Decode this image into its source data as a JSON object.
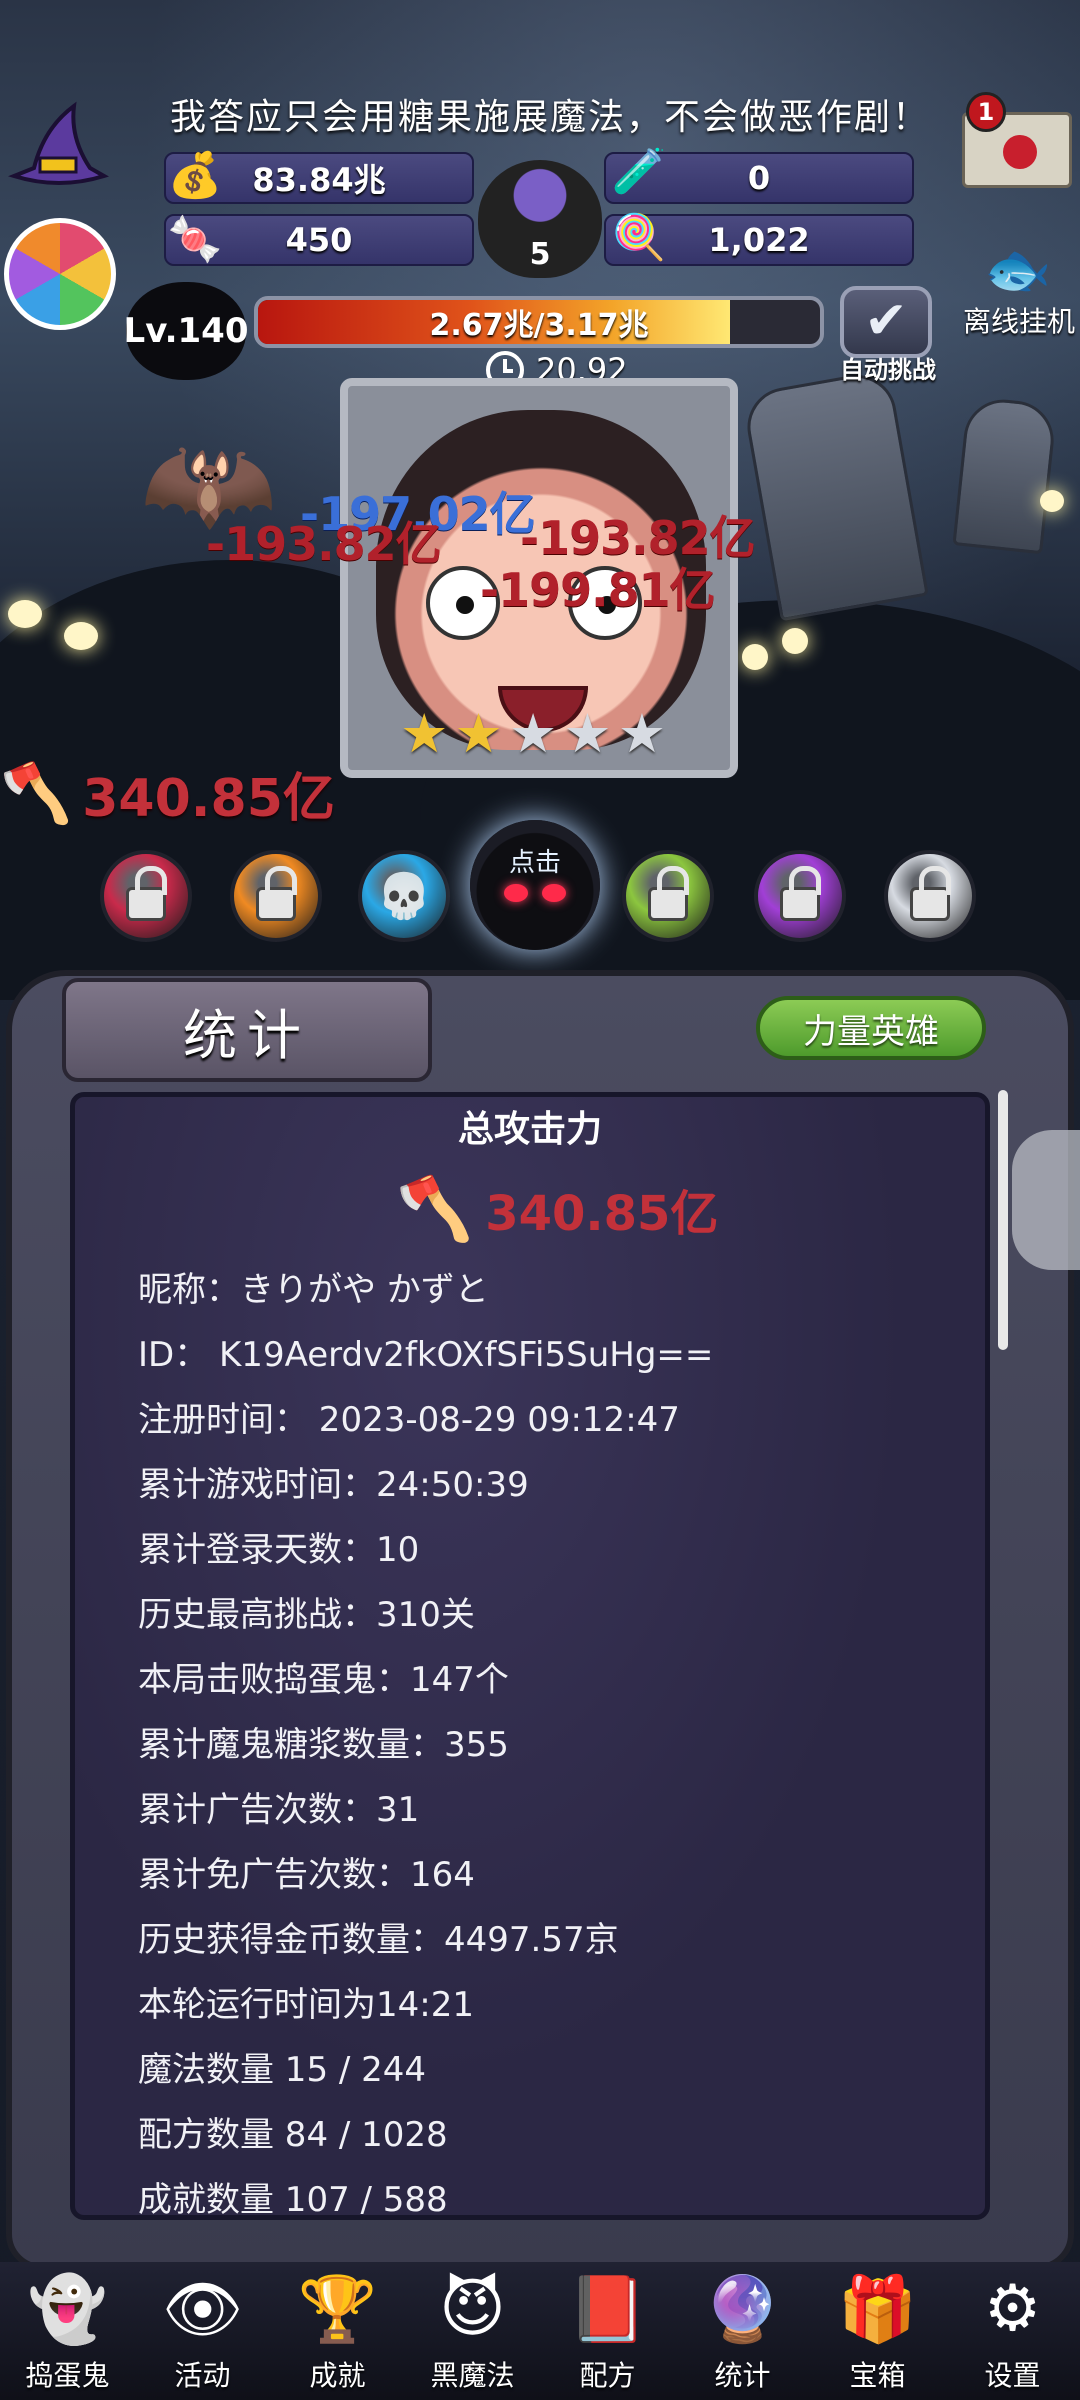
{
  "header": {
    "slogan": "我答应只会用糖果施展魔法，不会做恶作剧！",
    "resources": {
      "coins": "83.84兆",
      "potion": "0",
      "candy_wrap": "450",
      "candy_corn": "1,022",
      "cauldron_count": "5"
    },
    "mail_badge": "1",
    "offline_label": "离线挂机"
  },
  "level": {
    "label": "Lv.140",
    "hp_text": "2.67兆/3.17兆",
    "hp_progress": 0.84,
    "timer": "20.92",
    "auto_label": "自动挑战"
  },
  "battle": {
    "damage_popups": [
      "-197.02亿",
      "-193.82亿",
      "-193.82亿",
      "-199.81亿"
    ],
    "dps_value": "340.85亿",
    "stars_total": 5,
    "stars_lit": 2
  },
  "skills": {
    "active_label": "点击",
    "orb_colors": [
      "#c92a4b",
      "#f08a22",
      "#2aa8e6",
      "#0e0e12",
      "#8cc63f",
      "#a13fd6",
      "#d7dbe2"
    ]
  },
  "panel": {
    "tab_stats": "统计",
    "tab_power": "力量英雄",
    "title": "总攻击力",
    "total_power": "340.85亿",
    "stats": [
      "昵称：きりがや かずと",
      "ID： K19Aerdv2fkOXfSFi5SuHg==",
      "注册时间： 2023-08-29 09:12:47",
      "累计游戏时间：24:50:39",
      "累计登录天数：10",
      "历史最高挑战：310关",
      "本局击败捣蛋鬼：147个",
      "累计魔鬼糖浆数量：355",
      "累计广告次数：31",
      "累计免广告次数：164",
      "历史获得金币数量：4497.57京",
      "本轮运行时间为14:21",
      "魔法数量 15 / 244",
      "配方数量 84 / 1028",
      "成就数量 107 / 588"
    ]
  },
  "nav": [
    {
      "label": "捣蛋鬼",
      "icon": "ghost-icon"
    },
    {
      "label": "活动",
      "icon": "event-icon"
    },
    {
      "label": "成就",
      "icon": "skull-trophy-icon"
    },
    {
      "label": "黑魔法",
      "icon": "dark-magic-icon"
    },
    {
      "label": "配方",
      "icon": "recipe-book-icon"
    },
    {
      "label": "统计",
      "icon": "crystal-ball-icon"
    },
    {
      "label": "宝箱",
      "icon": "gift-box-icon"
    },
    {
      "label": "设置",
      "icon": "gear-icon"
    }
  ]
}
